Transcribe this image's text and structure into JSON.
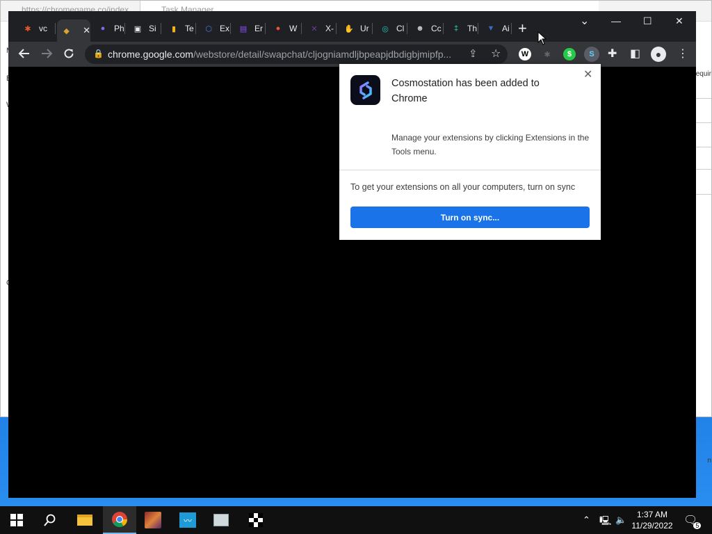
{
  "background_window": {
    "url_text": "https://chromegame.co/index",
    "task_manager_title": "Task Manager",
    "right_text": "equir",
    "right_text_2": "n",
    "left_letters": [
      "M",
      "B",
      "W",
      "C"
    ]
  },
  "tabs": [
    {
      "label": "vc",
      "icon": "gear-icon",
      "color": "#e8572a",
      "glyph": "✱"
    },
    {
      "label": "",
      "icon": "puzzle-folder-icon",
      "color": "#d9a52c",
      "glyph": "◆",
      "active": true
    },
    {
      "label": "Ph",
      "icon": "phantom-icon",
      "color": "#7b6cf0",
      "glyph": "●"
    },
    {
      "label": "Si",
      "icon": "image-icon",
      "color": "#e8eaed",
      "glyph": "▣"
    },
    {
      "label": "Te",
      "icon": "bottle-icon",
      "color": "#f2b21b",
      "glyph": "▮"
    },
    {
      "label": "Ex",
      "icon": "ex-icon",
      "color": "#4b7bec",
      "glyph": "⬡"
    },
    {
      "label": "Er",
      "icon": "er-icon",
      "color": "#8a4fff",
      "glyph": "▤"
    },
    {
      "label": "W",
      "icon": "w-icon",
      "color": "#f3523a",
      "glyph": "●"
    },
    {
      "label": "X-",
      "icon": "x-icon",
      "color": "#6a3fa0",
      "glyph": "✕"
    },
    {
      "label": "Ur",
      "icon": "hand-icon",
      "color": "#f6c530",
      "glyph": "✋"
    },
    {
      "label": "Cl",
      "icon": "cl-icon",
      "color": "#29c2b5",
      "glyph": "◎"
    },
    {
      "label": "Cc",
      "icon": "owl-icon",
      "color": "#c9c9c9",
      "glyph": "☻"
    },
    {
      "label": "Th",
      "icon": "th-icon",
      "color": "#2cb6a0",
      "glyph": "‡"
    },
    {
      "label": "Ai",
      "icon": "ai-icon",
      "color": "#3c69c8",
      "glyph": "▼"
    }
  ],
  "window_controls": {
    "minimize": "—",
    "maximize": "☐",
    "close": "✕",
    "dropdown": "⌄"
  },
  "toolbar": {
    "url_host": "chrome.google.com",
    "url_path": "/webstore/detail/swapchat/cljogniamdljbpeapjdbdigbjmipfp..."
  },
  "popup": {
    "title": "Cosmostation has been added to Chrome",
    "description": "Manage your extensions by clicking Extensions in the Tools menu.",
    "sync_text": "To get your extensions on all your computers, turn on sync",
    "button_label": "Turn on sync..."
  },
  "taskbar": {
    "time": "1:37 AM",
    "date": "11/29/2022",
    "notification_count": "5"
  }
}
